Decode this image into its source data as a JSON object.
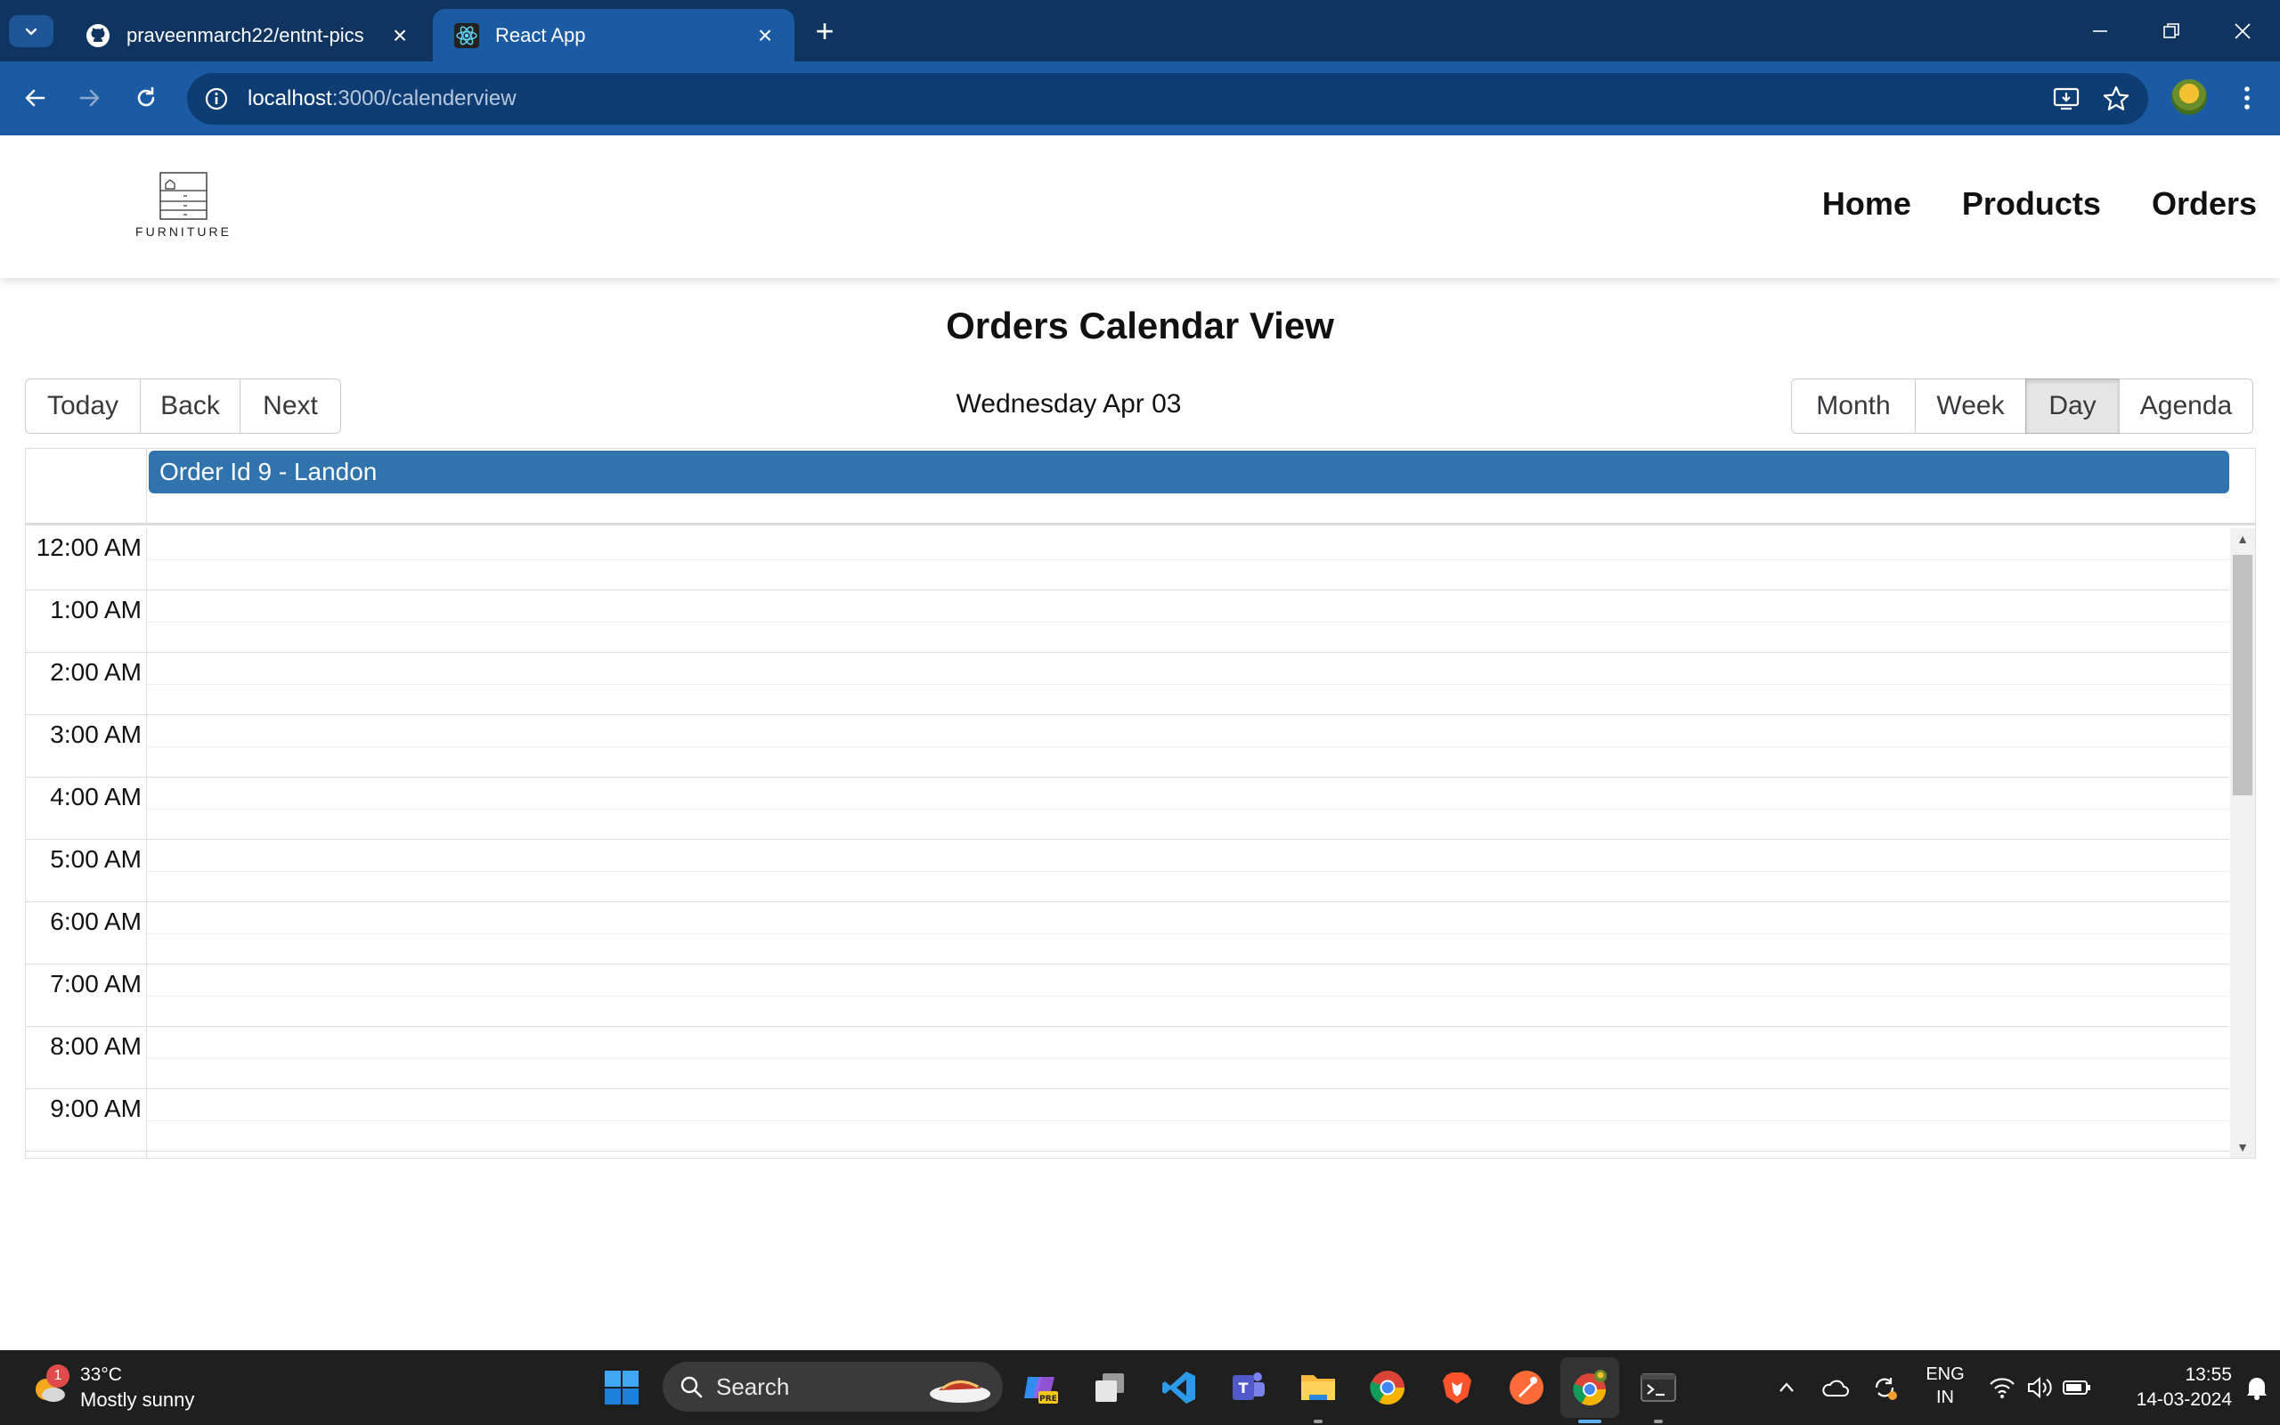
{
  "browser": {
    "tabs": [
      {
        "title": "praveenmarch22/entnt-pics",
        "icon": "github-icon",
        "active": false
      },
      {
        "title": "React App",
        "icon": "react-icon",
        "active": true
      }
    ],
    "url_host": "localhost",
    "url_path": ":3000/calenderview"
  },
  "site": {
    "logo_text": "FURNITURE",
    "nav": [
      "Home",
      "Products",
      "Orders"
    ]
  },
  "calendar": {
    "title": "Orders Calendar View",
    "nav_buttons": [
      "Today",
      "Back",
      "Next"
    ],
    "label": "Wednesday Apr 03",
    "view_buttons": [
      "Month",
      "Week",
      "Day",
      "Agenda"
    ],
    "active_view": "Day",
    "event_color": "#3174ad",
    "allday_events": [
      {
        "title": "Order Id 9 - Landon"
      }
    ],
    "time_slots": [
      "12:00 AM",
      "1:00 AM",
      "2:00 AM",
      "3:00 AM",
      "4:00 AM",
      "5:00 AM",
      "6:00 AM",
      "7:00 AM",
      "8:00 AM",
      "9:00 AM"
    ]
  },
  "taskbar": {
    "weather_temp": "33°C",
    "weather_desc": "Mostly sunny",
    "weather_badge": "1",
    "search_label": "Search",
    "lang_line1": "ENG",
    "lang_line2": "IN",
    "time": "13:55",
    "date": "14-03-2024"
  }
}
